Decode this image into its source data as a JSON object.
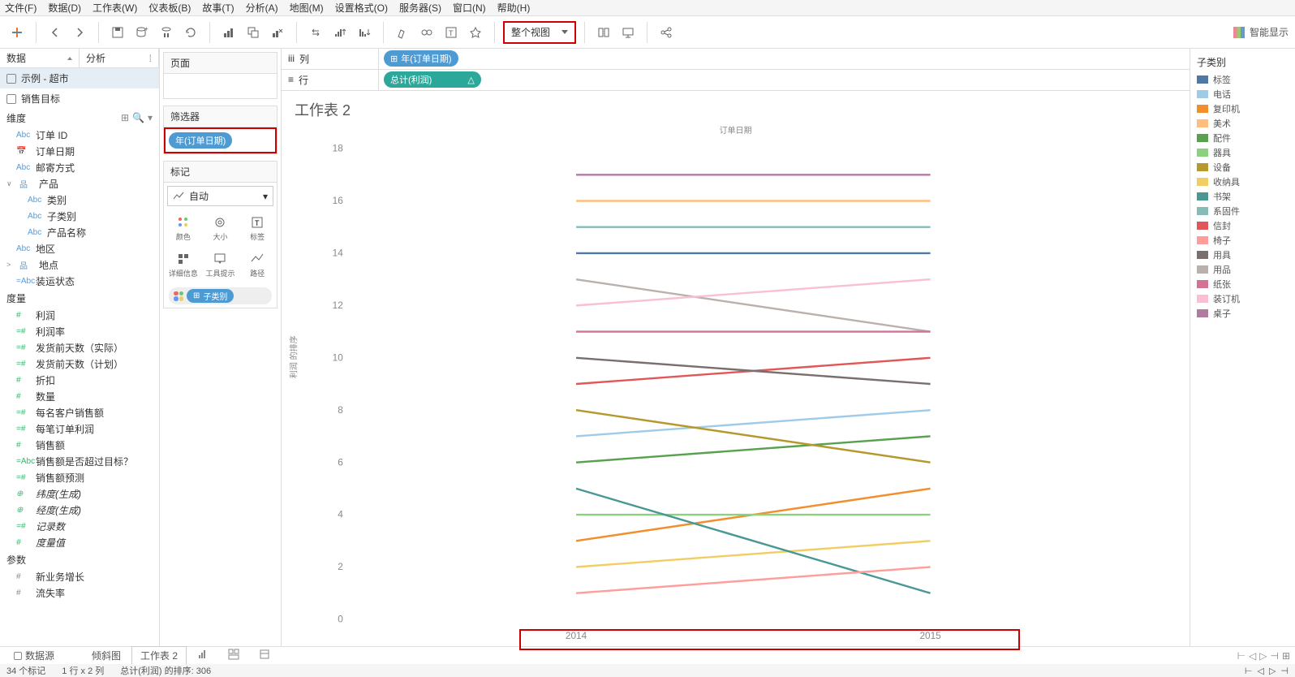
{
  "menu": {
    "file": "文件(F)",
    "data": "数据(D)",
    "worksheet": "工作表(W)",
    "dashboard": "仪表板(B)",
    "story": "故事(T)",
    "analysis": "分析(A)",
    "map": "地图(M)",
    "format": "设置格式(O)",
    "server": "服务器(S)",
    "window": "窗口(N)",
    "help": "帮助(H)"
  },
  "toolbar": {
    "fit_mode": "整个视图",
    "showme": "智能显示"
  },
  "left": {
    "tab_data": "数据",
    "tab_analysis": "分析",
    "ds1": "示例 - 超市",
    "ds2": "销售目标",
    "dimensions_header": "维度",
    "dims": [
      "订单 ID",
      "订单日期",
      "邮寄方式",
      "产品",
      "类别",
      "子类别",
      "产品名称",
      "地区",
      "地点",
      "装运状态"
    ],
    "measures_header": "度量",
    "meas": [
      "利润",
      "利润率",
      "发货前天数（实际）",
      "发货前天数（计划）",
      "折扣",
      "数量",
      "每名客户销售额",
      "每笔订单利润",
      "销售额",
      "销售额是否超过目标？",
      "销售额预测",
      "纬度(生成)",
      "经度(生成)",
      "记录数",
      "度量值"
    ],
    "params_header": "参数",
    "params": [
      "新业务增长",
      "流失率"
    ]
  },
  "shelves": {
    "pages": "页面",
    "filters": "筛选器",
    "filter_pill": "年(订单日期)",
    "marks": "标记",
    "mark_type": "自动",
    "marks_grid": [
      "颜色",
      "大小",
      "标签",
      "详细信息",
      "工具提示",
      "路径"
    ],
    "color_pill": "子类别",
    "columns_lbl": "列",
    "rows_lbl": "行",
    "col_pill": "年(订单日期)",
    "row_pill": "总计(利润)"
  },
  "viz": {
    "title": "工作表 2",
    "x_title": "订单日期",
    "y_title": "利润 的排序"
  },
  "legend": {
    "title": "子类别",
    "items": [
      {
        "label": "标签",
        "color": "#4e79a7"
      },
      {
        "label": "电话",
        "color": "#a0cbe8"
      },
      {
        "label": "复印机",
        "color": "#f28e2b"
      },
      {
        "label": "美术",
        "color": "#ffbe7d"
      },
      {
        "label": "配件",
        "color": "#59a14f"
      },
      {
        "label": "器具",
        "color": "#8cd17d"
      },
      {
        "label": "设备",
        "color": "#b6992d"
      },
      {
        "label": "收纳具",
        "color": "#f1ce63"
      },
      {
        "label": "书架",
        "color": "#499894"
      },
      {
        "label": "系固件",
        "color": "#86bcb6"
      },
      {
        "label": "信封",
        "color": "#e15759"
      },
      {
        "label": "椅子",
        "color": "#ff9d9a"
      },
      {
        "label": "用具",
        "color": "#79706e"
      },
      {
        "label": "用品",
        "color": "#bab0ac"
      },
      {
        "label": "纸张",
        "color": "#d37295"
      },
      {
        "label": "装订机",
        "color": "#fabfd2"
      },
      {
        "label": "桌子",
        "color": "#b07aa1"
      }
    ]
  },
  "bottom": {
    "datasource": "数据源",
    "tab1": "倾斜图",
    "tab2": "工作表 2"
  },
  "status": {
    "marks": "34 个标记",
    "rowcol": "1 行 x 2 列",
    "sum": "总计(利润) 的排序: 306"
  },
  "chart_data": {
    "type": "line",
    "xlabel": "订单日期",
    "ylabel": "利润 的排序",
    "ylim": [
      0,
      18
    ],
    "categories": [
      "2014",
      "2015"
    ],
    "series": [
      {
        "name": "标签",
        "color": "#4e79a7",
        "values": [
          14,
          14
        ]
      },
      {
        "name": "电话",
        "color": "#a0cbe8",
        "values": [
          7,
          8
        ]
      },
      {
        "name": "复印机",
        "color": "#f28e2b",
        "values": [
          3,
          5
        ]
      },
      {
        "name": "美术",
        "color": "#ffbe7d",
        "values": [
          16,
          16
        ]
      },
      {
        "name": "配件",
        "color": "#59a14f",
        "values": [
          6,
          7
        ]
      },
      {
        "name": "器具",
        "color": "#8cd17d",
        "values": [
          4,
          4
        ]
      },
      {
        "name": "设备",
        "color": "#b6992d",
        "values": [
          8,
          6
        ]
      },
      {
        "name": "收纳具",
        "color": "#f1ce63",
        "values": [
          2,
          3
        ]
      },
      {
        "name": "书架",
        "color": "#499894",
        "values": [
          5,
          1
        ]
      },
      {
        "name": "系固件",
        "color": "#86bcb6",
        "values": [
          15,
          15
        ]
      },
      {
        "name": "信封",
        "color": "#e15759",
        "values": [
          9,
          10
        ]
      },
      {
        "name": "椅子",
        "color": "#ff9d9a",
        "values": [
          1,
          2
        ]
      },
      {
        "name": "用具",
        "color": "#79706e",
        "values": [
          10,
          9
        ]
      },
      {
        "name": "用品",
        "color": "#bab0ac",
        "values": [
          13,
          11
        ]
      },
      {
        "name": "纸张",
        "color": "#d37295",
        "values": [
          11,
          11
        ]
      },
      {
        "name": "装订机",
        "color": "#fabfd2",
        "values": [
          12,
          13
        ]
      },
      {
        "name": "桌子",
        "color": "#b07aa1",
        "values": [
          17,
          17
        ]
      }
    ]
  }
}
